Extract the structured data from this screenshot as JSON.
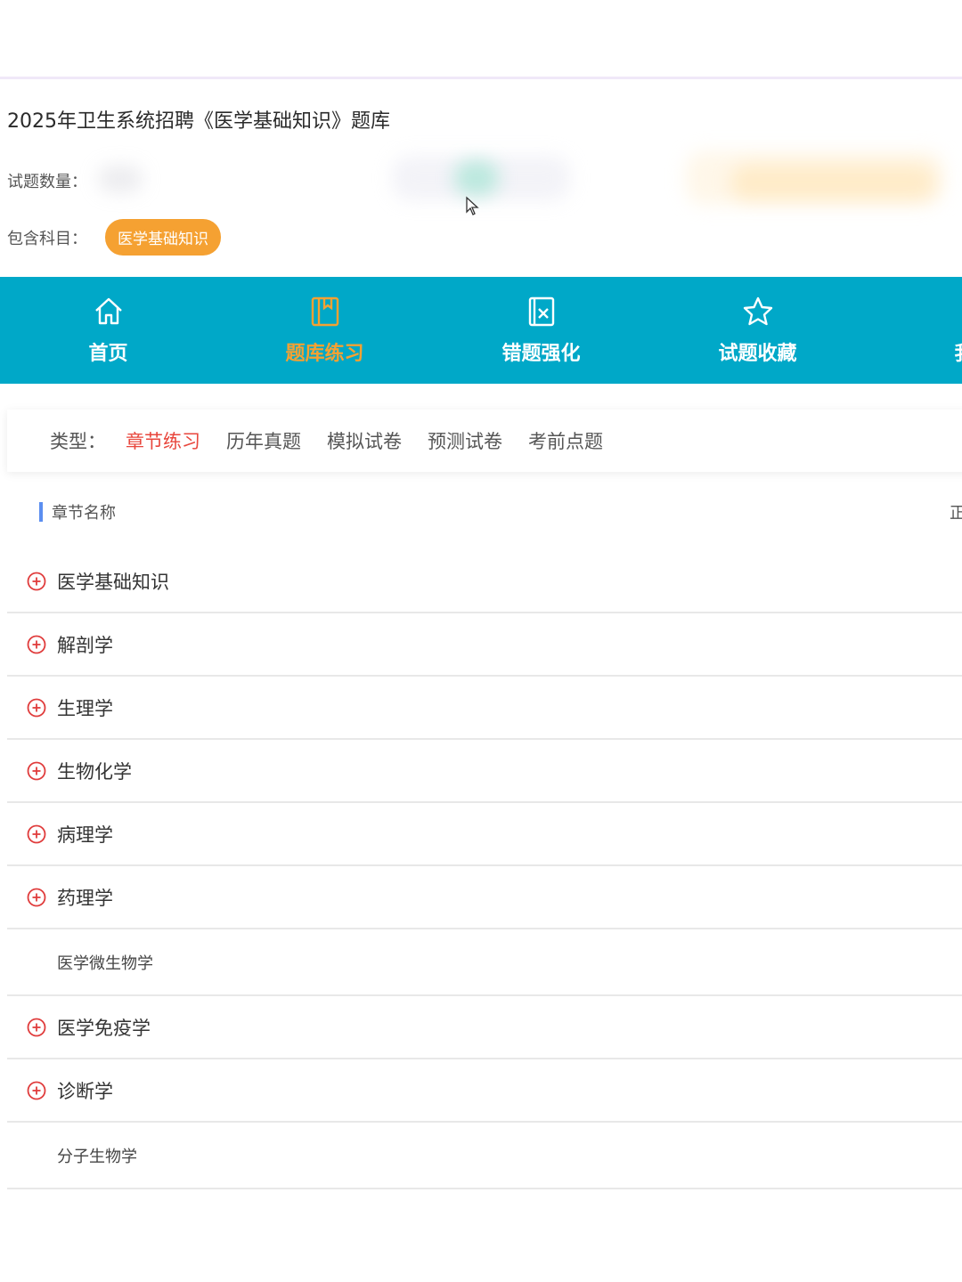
{
  "exam": {
    "title": "2025年卫生系统招聘《医学基础知识》题库",
    "count_label": "试题数量：",
    "subjects_label": "包含科目：",
    "subject_badge": "医学基础知识"
  },
  "nav": {
    "items": [
      {
        "label": "首页",
        "icon": "home-icon"
      },
      {
        "label": "题库练习",
        "icon": "book-icon",
        "active": true
      },
      {
        "label": "错题强化",
        "icon": "wrong-question-icon"
      },
      {
        "label": "试题收藏",
        "icon": "star-icon"
      },
      {
        "label": "我的"
      }
    ],
    "background": "#00a8c8",
    "active_color": "#f5a132"
  },
  "types": {
    "label": "类型：",
    "options": [
      "章节练习",
      "历年真题",
      "模拟试卷",
      "预测试卷",
      "考前点题"
    ],
    "active": "章节练习",
    "active_color": "#e8463c"
  },
  "section": {
    "title": "章节名称",
    "right_text": "正"
  },
  "chapters": [
    {
      "name": "医学基础知识",
      "expandable": true
    },
    {
      "name": "解剖学",
      "expandable": true
    },
    {
      "name": "生理学",
      "expandable": true
    },
    {
      "name": "生物化学",
      "expandable": true
    },
    {
      "name": "病理学",
      "expandable": true
    },
    {
      "name": "药理学",
      "expandable": true
    },
    {
      "name": "医学微生物学",
      "expandable": false
    },
    {
      "name": "医学免疫学",
      "expandable": true
    },
    {
      "name": "诊断学",
      "expandable": true
    },
    {
      "name": "分子生物学",
      "expandable": false
    }
  ]
}
